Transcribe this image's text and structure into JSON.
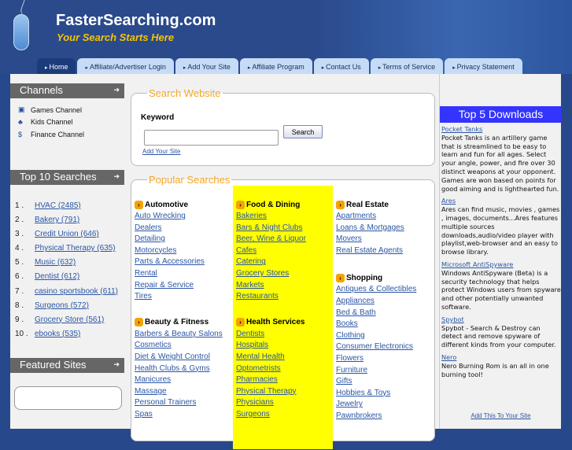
{
  "header": {
    "title": "FasterSearching.com",
    "tagline": "Your Search Starts Here"
  },
  "tabs": [
    "Home",
    "Affiliate/Advertiser Login",
    "Add Your Site",
    "Affiliate Program",
    "Contact Us",
    "Terms of Service",
    "Privacy Statement"
  ],
  "sidebar": {
    "channels_title": "Channels",
    "channels": [
      {
        "icon": "games-icon",
        "glyph": "▣",
        "label": "Games Channel"
      },
      {
        "icon": "kids-icon",
        "glyph": "♣",
        "label": "Kids Channel"
      },
      {
        "icon": "finance-icon",
        "glyph": "$",
        "label": "Finance Channel"
      }
    ],
    "top10_title": "Top 10 Searches",
    "top10": [
      [
        "1 .",
        "HVAC (2485)"
      ],
      [
        "2 .",
        "Bakery (791)"
      ],
      [
        "3 .",
        "Credit Union (646)"
      ],
      [
        "4 .",
        "Physical Therapy (635)"
      ],
      [
        "5 .",
        "Music (632)"
      ],
      [
        "6 .",
        "Dentist (612)"
      ],
      [
        "7 .",
        "casino sportsbook (611)"
      ],
      [
        "8 .",
        "Surgeons (572)"
      ],
      [
        "9 .",
        "Grocery Store (561)"
      ],
      [
        "10 .",
        "ebooks (535)"
      ]
    ],
    "featured_title": "Featured Sites"
  },
  "search": {
    "legend": "Search Website",
    "keyword_label": "Keyword",
    "keyword_value": "",
    "button": "Search",
    "add_site": "Add Your Site"
  },
  "popular": {
    "legend": "Popular Searches",
    "columns": [
      [
        {
          "title": "Automotive",
          "links": [
            "Auto Wrecking",
            "Dealers",
            "Detailing",
            "Motorcycles",
            "Parts & Accessories",
            "Rental",
            "Repair & Service",
            "Tires"
          ]
        },
        {
          "title": "Beauty & Fitness",
          "links": [
            "Barbers & Beauty Salons",
            "Cosmetics",
            "Diet & Weight Control",
            "Health Clubs & Gyms",
            "Manicures",
            "Massage",
            "Personal Trainers",
            "Spas"
          ]
        }
      ],
      [
        {
          "title": "Food & Dining",
          "links": [
            "Bakeries",
            "Bars & Night Clubs",
            "Beer, Wine & Liquor",
            "Cafes",
            "Catering",
            "Grocery Stores",
            "Markets",
            "Restaurants"
          ]
        },
        {
          "title": "Health Services",
          "links": [
            "Dentists",
            "Hospitals",
            "Mental Health",
            "Optometrists",
            "Pharmacies",
            "Physical Therapy",
            "Physicians",
            "Surgeons"
          ]
        }
      ],
      [
        {
          "title": "Real Estate",
          "links": [
            "Apartments",
            "Loans & Mortgages",
            "Movers",
            "Real Estate Agents"
          ]
        },
        {
          "title": "Shopping",
          "links": [
            "Antiques & Collectibles",
            "Appliances",
            "Bed & Bath",
            "Books",
            "Clothing",
            "Consumer Electronics",
            "Flowers",
            "Furniture",
            "Gifts",
            "Hobbies & Toys",
            "Jewelry",
            "Pawnbrokers"
          ]
        }
      ]
    ],
    "highlight_color": "#ffff00"
  },
  "downloads": {
    "title": "Top 5 Downloads",
    "items": [
      {
        "name": "Pocket Tanks",
        "desc": "Pocket Tanks is an artillery game that is streamlined to be easy to learn and fun for all ages. Select your angle, power, and fire over 30 distinct weapons at your opponent. Games are won based on points for good aiming and is lighthearted fun."
      },
      {
        "name": "Ares",
        "desc": "Ares can find music, movies , games , images, documents...Ares features multiple sources downloads,audio/video player with playlist,web-browser and an easy to browse library."
      },
      {
        "name": "Microsoft AntiSpyware",
        "desc": "Windows AntiSpyware (Beta) is a security technology that helps protect Windows users from spyware and other potentially unwanted software."
      },
      {
        "name": "Spybot",
        "desc": "Spybot - Search & Destroy can detect and remove spyware of different kinds from your computer."
      },
      {
        "name": "Nero",
        "desc": "Nero Burning Rom is an all in one burning tool!"
      }
    ],
    "add": "Add This To Your Site"
  }
}
